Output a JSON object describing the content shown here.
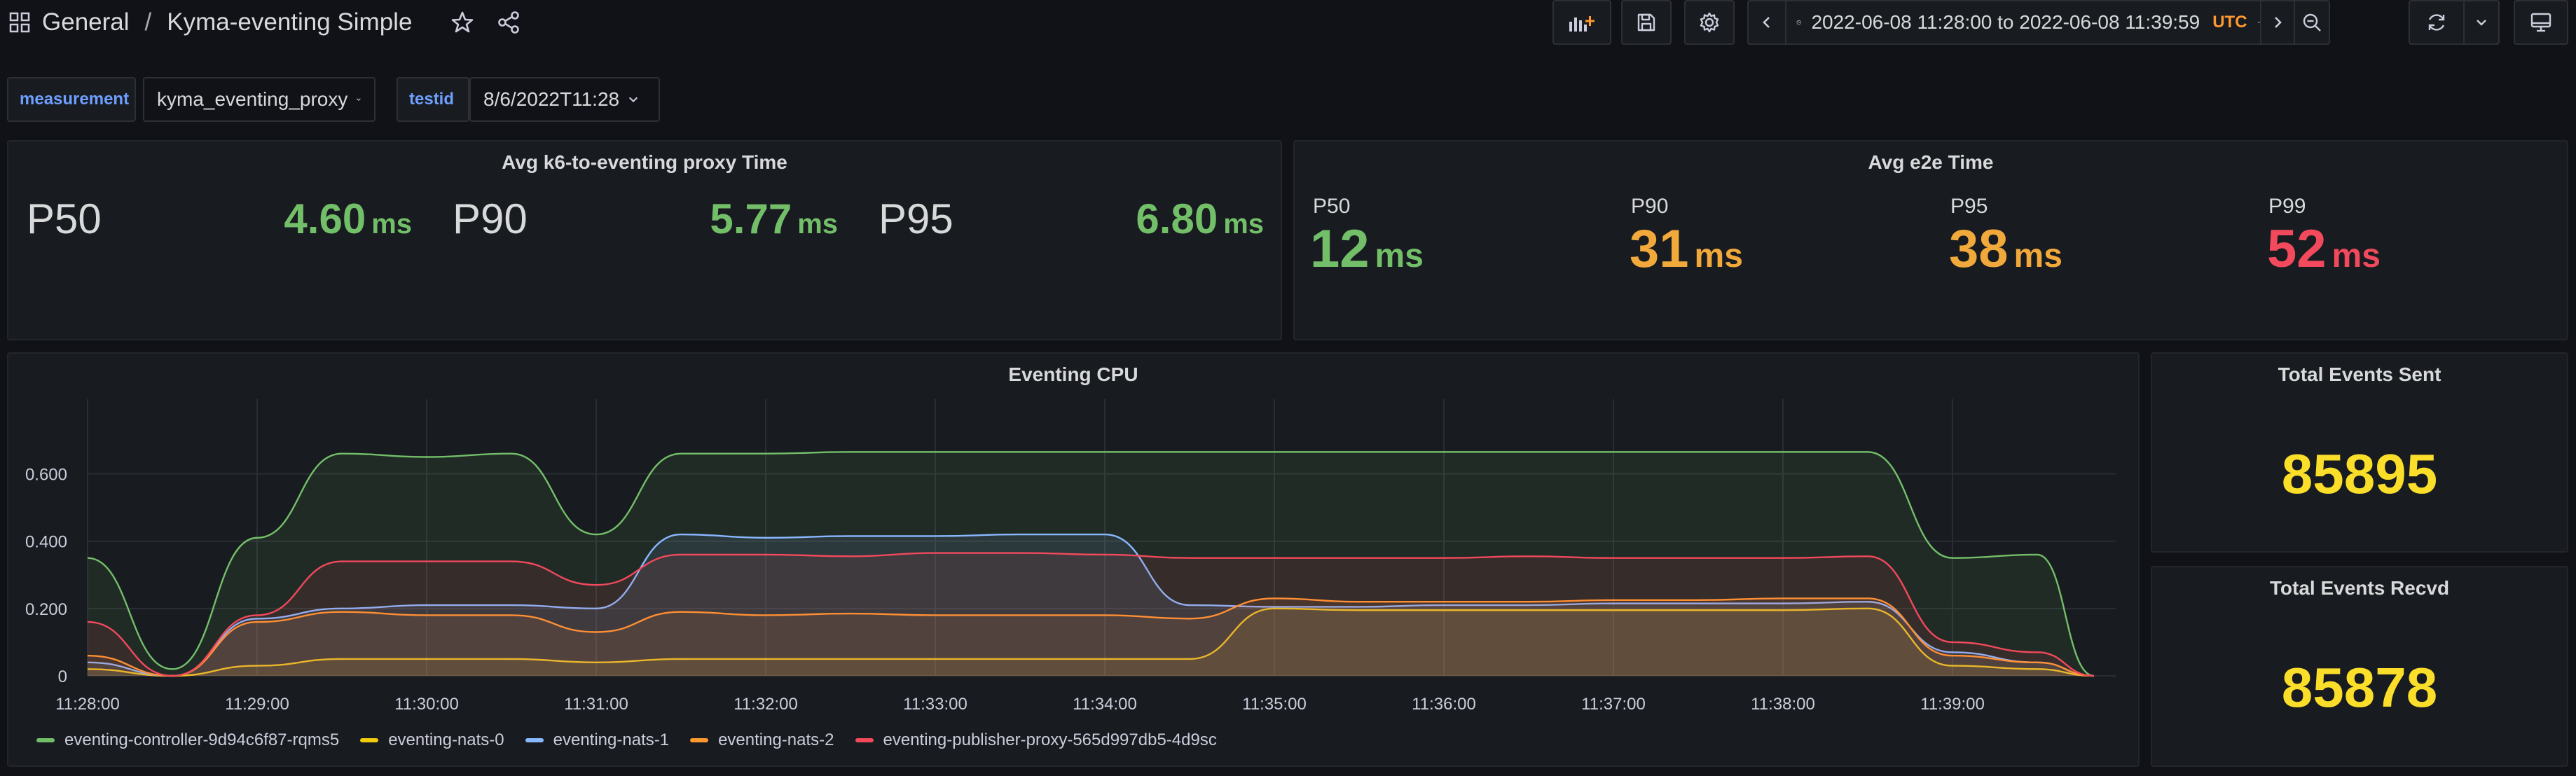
{
  "header": {
    "folder": "General",
    "separator": "/",
    "title": "Kyma-eventing Simple"
  },
  "timepicker": {
    "range": "2022-06-08 11:28:00 to 2022-06-08 11:39:59",
    "timezone": "UTC"
  },
  "variables": [
    {
      "label": "measurement",
      "value": "kyma_eventing_proxy"
    },
    {
      "label": "testid",
      "value": "8/6/2022T11:28"
    }
  ],
  "panels": {
    "proxy_time": {
      "title": "Avg k6-to-eventing proxy Time",
      "stats": [
        {
          "name": "P50",
          "value": "4.60",
          "unit": "ms",
          "color": "#73bf69"
        },
        {
          "name": "P90",
          "value": "5.77",
          "unit": "ms",
          "color": "#73bf69"
        },
        {
          "name": "P95",
          "value": "6.80",
          "unit": "ms",
          "color": "#73bf69"
        }
      ]
    },
    "e2e_time": {
      "title": "Avg e2e Time",
      "stats": [
        {
          "name": "P50",
          "value": "12",
          "unit": "ms",
          "color": "#73bf69"
        },
        {
          "name": "P90",
          "value": "31",
          "unit": "ms",
          "color": "#f2a93b"
        },
        {
          "name": "P95",
          "value": "38",
          "unit": "ms",
          "color": "#f2a93b"
        },
        {
          "name": "P99",
          "value": "52",
          "unit": "ms",
          "color": "#f2495c"
        }
      ]
    },
    "events_sent": {
      "title": "Total Events Sent",
      "value": "85895",
      "color": "#fade2a"
    },
    "events_recvd": {
      "title": "Total Events Recvd",
      "value": "85878",
      "color": "#fade2a"
    },
    "cpu": {
      "title": "Eventing CPU"
    }
  },
  "colors": {
    "green": "#73bf69",
    "yellow": "#fade2a",
    "orange": "#ff9830",
    "red": "#f2495c",
    "blue": "#6e9fff"
  },
  "icons": [
    "apps-icon",
    "star-icon",
    "share-icon",
    "add-panel-icon",
    "save-icon",
    "gear-icon",
    "chevron-left-icon",
    "clock-icon",
    "chevron-down-icon",
    "chevron-right-icon",
    "zoom-out-icon",
    "refresh-icon",
    "tv-icon"
  ],
  "chart_data": {
    "type": "area",
    "title": "Eventing CPU",
    "xlabel": "",
    "ylabel": "",
    "x": [
      "11:28:00",
      "11:28:30",
      "11:29:00",
      "11:29:30",
      "11:30:00",
      "11:30:30",
      "11:31:00",
      "11:31:30",
      "11:32:00",
      "11:32:30",
      "11:33:00",
      "11:33:30",
      "11:34:00",
      "11:34:30",
      "11:35:00",
      "11:35:30",
      "11:36:00",
      "11:36:30",
      "11:37:00",
      "11:37:30",
      "11:38:00",
      "11:38:30",
      "11:39:00",
      "11:39:30",
      "11:39:50"
    ],
    "x_ticks": [
      "11:28:00",
      "11:29:00",
      "11:30:00",
      "11:31:00",
      "11:32:00",
      "11:33:00",
      "11:34:00",
      "11:35:00",
      "11:36:00",
      "11:37:00",
      "11:38:00",
      "11:39:00"
    ],
    "y_ticks": [
      "0",
      "0.200",
      "0.400",
      "0.600"
    ],
    "ylim": [
      0,
      0.78
    ],
    "grid": true,
    "legend": "bottom",
    "series": [
      {
        "name": "eventing-controller-9d94c6f87-rqms5",
        "color": "#73bf69",
        "values": [
          0.35,
          0.02,
          0.41,
          0.66,
          0.65,
          0.66,
          0.42,
          0.66,
          0.66,
          0.665,
          0.665,
          0.665,
          0.665,
          0.665,
          0.665,
          0.665,
          0.665,
          0.665,
          0.665,
          0.665,
          0.665,
          0.665,
          0.35,
          0.36,
          0.0
        ]
      },
      {
        "name": "eventing-nats-0",
        "color": "#f2cc0c",
        "values": [
          0.02,
          0.0,
          0.03,
          0.05,
          0.05,
          0.05,
          0.04,
          0.05,
          0.05,
          0.05,
          0.05,
          0.05,
          0.05,
          0.05,
          0.2,
          0.195,
          0.195,
          0.195,
          0.195,
          0.195,
          0.195,
          0.2,
          0.03,
          0.02,
          0.0
        ]
      },
      {
        "name": "eventing-nats-1",
        "color": "#8ab8ff",
        "values": [
          0.04,
          0.0,
          0.17,
          0.2,
          0.21,
          0.21,
          0.2,
          0.42,
          0.41,
          0.415,
          0.415,
          0.42,
          0.42,
          0.21,
          0.205,
          0.205,
          0.21,
          0.21,
          0.215,
          0.215,
          0.215,
          0.22,
          0.07,
          0.04,
          0.0
        ]
      },
      {
        "name": "eventing-nats-2",
        "color": "#ff9830",
        "values": [
          0.06,
          0.0,
          0.16,
          0.19,
          0.18,
          0.18,
          0.13,
          0.19,
          0.18,
          0.185,
          0.18,
          0.18,
          0.18,
          0.17,
          0.23,
          0.22,
          0.22,
          0.22,
          0.225,
          0.225,
          0.23,
          0.23,
          0.06,
          0.04,
          0.0
        ]
      },
      {
        "name": "eventing-publisher-proxy-565d997db5-4d9sc",
        "color": "#f2495c",
        "values": [
          0.16,
          0.0,
          0.18,
          0.34,
          0.34,
          0.34,
          0.27,
          0.36,
          0.36,
          0.355,
          0.365,
          0.365,
          0.36,
          0.35,
          0.35,
          0.35,
          0.35,
          0.355,
          0.35,
          0.35,
          0.35,
          0.355,
          0.1,
          0.07,
          0.0
        ]
      }
    ]
  }
}
